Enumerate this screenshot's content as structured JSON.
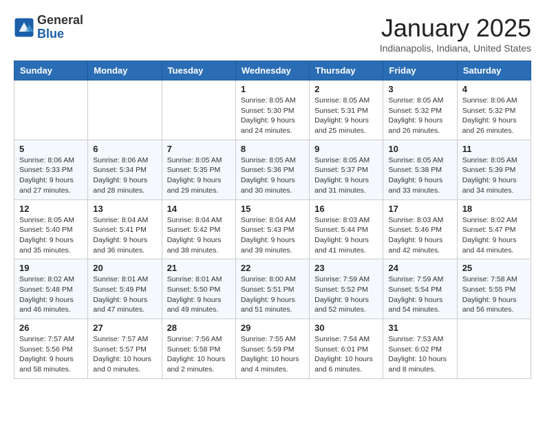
{
  "header": {
    "logo": {
      "general": "General",
      "blue": "Blue"
    },
    "title": "January 2025",
    "location": "Indianapolis, Indiana, United States"
  },
  "weekdays": [
    "Sunday",
    "Monday",
    "Tuesday",
    "Wednesday",
    "Thursday",
    "Friday",
    "Saturday"
  ],
  "weeks": [
    [
      {
        "day": "",
        "info": ""
      },
      {
        "day": "",
        "info": ""
      },
      {
        "day": "",
        "info": ""
      },
      {
        "day": "1",
        "info": "Sunrise: 8:05 AM\nSunset: 5:30 PM\nDaylight: 9 hours and 24 minutes."
      },
      {
        "day": "2",
        "info": "Sunrise: 8:05 AM\nSunset: 5:31 PM\nDaylight: 9 hours and 25 minutes."
      },
      {
        "day": "3",
        "info": "Sunrise: 8:05 AM\nSunset: 5:32 PM\nDaylight: 9 hours and 26 minutes."
      },
      {
        "day": "4",
        "info": "Sunrise: 8:06 AM\nSunset: 5:32 PM\nDaylight: 9 hours and 26 minutes."
      }
    ],
    [
      {
        "day": "5",
        "info": "Sunrise: 8:06 AM\nSunset: 5:33 PM\nDaylight: 9 hours and 27 minutes."
      },
      {
        "day": "6",
        "info": "Sunrise: 8:06 AM\nSunset: 5:34 PM\nDaylight: 9 hours and 28 minutes."
      },
      {
        "day": "7",
        "info": "Sunrise: 8:05 AM\nSunset: 5:35 PM\nDaylight: 9 hours and 29 minutes."
      },
      {
        "day": "8",
        "info": "Sunrise: 8:05 AM\nSunset: 5:36 PM\nDaylight: 9 hours and 30 minutes."
      },
      {
        "day": "9",
        "info": "Sunrise: 8:05 AM\nSunset: 5:37 PM\nDaylight: 9 hours and 31 minutes."
      },
      {
        "day": "10",
        "info": "Sunrise: 8:05 AM\nSunset: 5:38 PM\nDaylight: 9 hours and 33 minutes."
      },
      {
        "day": "11",
        "info": "Sunrise: 8:05 AM\nSunset: 5:39 PM\nDaylight: 9 hours and 34 minutes."
      }
    ],
    [
      {
        "day": "12",
        "info": "Sunrise: 8:05 AM\nSunset: 5:40 PM\nDaylight: 9 hours and 35 minutes."
      },
      {
        "day": "13",
        "info": "Sunrise: 8:04 AM\nSunset: 5:41 PM\nDaylight: 9 hours and 36 minutes."
      },
      {
        "day": "14",
        "info": "Sunrise: 8:04 AM\nSunset: 5:42 PM\nDaylight: 9 hours and 38 minutes."
      },
      {
        "day": "15",
        "info": "Sunrise: 8:04 AM\nSunset: 5:43 PM\nDaylight: 9 hours and 39 minutes."
      },
      {
        "day": "16",
        "info": "Sunrise: 8:03 AM\nSunset: 5:44 PM\nDaylight: 9 hours and 41 minutes."
      },
      {
        "day": "17",
        "info": "Sunrise: 8:03 AM\nSunset: 5:46 PM\nDaylight: 9 hours and 42 minutes."
      },
      {
        "day": "18",
        "info": "Sunrise: 8:02 AM\nSunset: 5:47 PM\nDaylight: 9 hours and 44 minutes."
      }
    ],
    [
      {
        "day": "19",
        "info": "Sunrise: 8:02 AM\nSunset: 5:48 PM\nDaylight: 9 hours and 46 minutes."
      },
      {
        "day": "20",
        "info": "Sunrise: 8:01 AM\nSunset: 5:49 PM\nDaylight: 9 hours and 47 minutes."
      },
      {
        "day": "21",
        "info": "Sunrise: 8:01 AM\nSunset: 5:50 PM\nDaylight: 9 hours and 49 minutes."
      },
      {
        "day": "22",
        "info": "Sunrise: 8:00 AM\nSunset: 5:51 PM\nDaylight: 9 hours and 51 minutes."
      },
      {
        "day": "23",
        "info": "Sunrise: 7:59 AM\nSunset: 5:52 PM\nDaylight: 9 hours and 52 minutes."
      },
      {
        "day": "24",
        "info": "Sunrise: 7:59 AM\nSunset: 5:54 PM\nDaylight: 9 hours and 54 minutes."
      },
      {
        "day": "25",
        "info": "Sunrise: 7:58 AM\nSunset: 5:55 PM\nDaylight: 9 hours and 56 minutes."
      }
    ],
    [
      {
        "day": "26",
        "info": "Sunrise: 7:57 AM\nSunset: 5:56 PM\nDaylight: 9 hours and 58 minutes."
      },
      {
        "day": "27",
        "info": "Sunrise: 7:57 AM\nSunset: 5:57 PM\nDaylight: 10 hours and 0 minutes."
      },
      {
        "day": "28",
        "info": "Sunrise: 7:56 AM\nSunset: 5:58 PM\nDaylight: 10 hours and 2 minutes."
      },
      {
        "day": "29",
        "info": "Sunrise: 7:55 AM\nSunset: 5:59 PM\nDaylight: 10 hours and 4 minutes."
      },
      {
        "day": "30",
        "info": "Sunrise: 7:54 AM\nSunset: 6:01 PM\nDaylight: 10 hours and 6 minutes."
      },
      {
        "day": "31",
        "info": "Sunrise: 7:53 AM\nSunset: 6:02 PM\nDaylight: 10 hours and 8 minutes."
      },
      {
        "day": "",
        "info": ""
      }
    ]
  ]
}
